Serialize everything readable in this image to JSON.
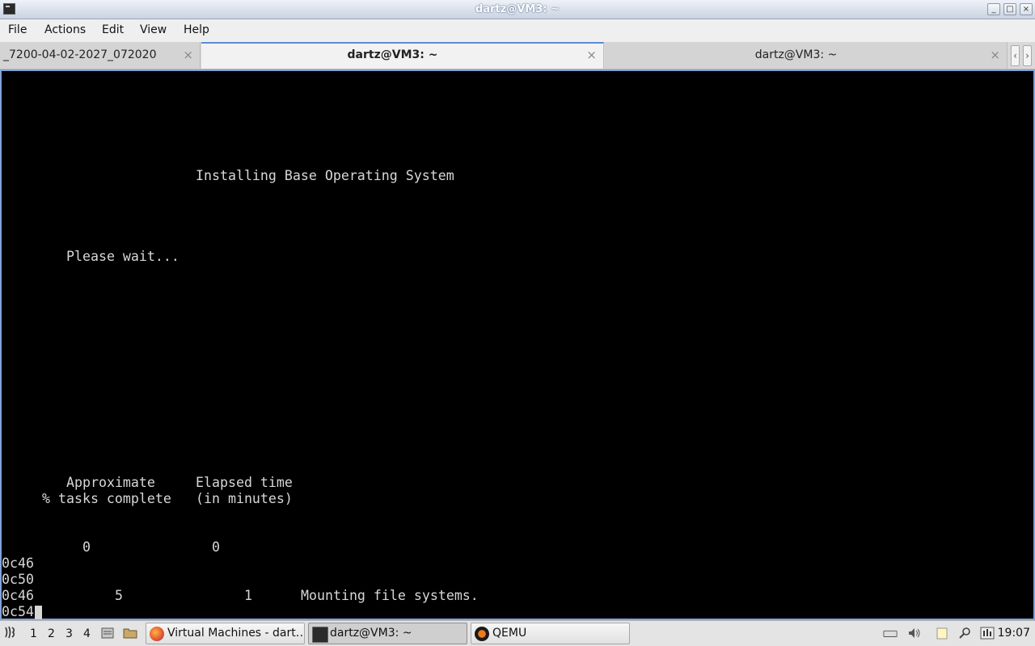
{
  "window": {
    "title": "dartz@VM3: ~",
    "controls": {
      "minimize": "_",
      "maximize": "□",
      "close": "×"
    }
  },
  "menu": [
    "File",
    "Actions",
    "Edit",
    "View",
    "Help"
  ],
  "tabs": [
    {
      "label": "_7200-04-02-2027_072020",
      "active": false
    },
    {
      "label": "dartz@VM3: ~",
      "active": true
    },
    {
      "label": "dartz@VM3: ~",
      "active": false
    }
  ],
  "tab_close_glyph": "×",
  "tab_scroll": {
    "left": "‹",
    "right": "›"
  },
  "terminal": {
    "heading": "Installing Base Operating System",
    "wait": "Please wait...",
    "col1_line1": "Approximate",
    "col1_line2": "% tasks complete",
    "col2_line1": "Elapsed time",
    "col2_line2": "(in minutes)",
    "row1_pct": "0",
    "row1_min": "0",
    "codes": [
      "0c46",
      "0c50",
      "0c46",
      "0c54"
    ],
    "row2_pct": "5",
    "row2_min": "1",
    "row2_msg": "Mounting file systems."
  },
  "taskbar": {
    "workspaces": [
      "1",
      "2",
      "3",
      "4"
    ],
    "tasks": [
      {
        "label": "Virtual Machines - dart…",
        "icon": "firefox-icon"
      },
      {
        "label": "dartz@VM3: ~",
        "icon": "terminal-icon"
      },
      {
        "label": "QEMU",
        "icon": "qemu-icon"
      }
    ],
    "clock": "19:07"
  },
  "colors": {
    "terminal_bg": "#000000",
    "terminal_fg": "#d7d7d7",
    "active_tab_accent": "#5b8dd6"
  }
}
